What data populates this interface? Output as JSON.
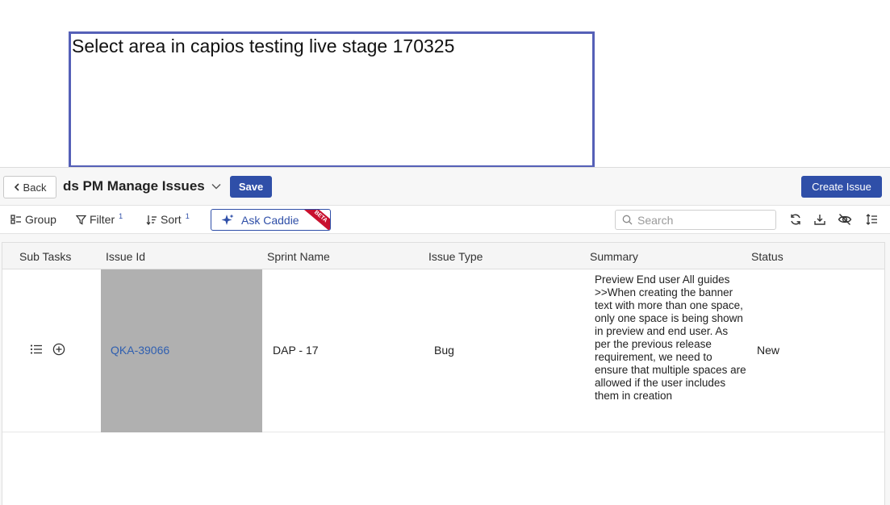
{
  "overlay": {
    "select_text": "Select area in capios testing live stage 170325"
  },
  "header": {
    "back_label": "Back",
    "view_title": "ds PM Manage Issues",
    "save_label": "Save",
    "create_label": "Create Issue"
  },
  "toolbar": {
    "group_label": "Group",
    "filter_label": "Filter",
    "filter_count": "1",
    "sort_label": "Sort",
    "sort_count": "1",
    "ask_caddie_label": "Ask Caddie",
    "beta_label": "BETA",
    "search_placeholder": "Search"
  },
  "table": {
    "columns": [
      "Sub Tasks",
      "Issue Id",
      "Sprint Name",
      "Issue Type",
      "Summary",
      "Status"
    ],
    "rows": [
      {
        "issue_id": "QKA-39066",
        "sprint_name": "DAP - 17",
        "issue_type": "Bug",
        "summary": "Preview End user All guides >>When creating the banner text with more than one space, only one space is being shown in preview and end user. As per the previous release requirement, we need to ensure that multiple spaces are allowed if the user includes them in creation",
        "status": "New"
      }
    ]
  },
  "icons": {
    "refresh": "refresh-icon",
    "download": "download-icon",
    "hide": "eye-off-icon",
    "row_height": "row-height-icon"
  },
  "colors": {
    "primary": "#2f4fa8",
    "selection_border": "#5560b7",
    "link": "#2f5fb0",
    "beta": "#c8102e"
  }
}
